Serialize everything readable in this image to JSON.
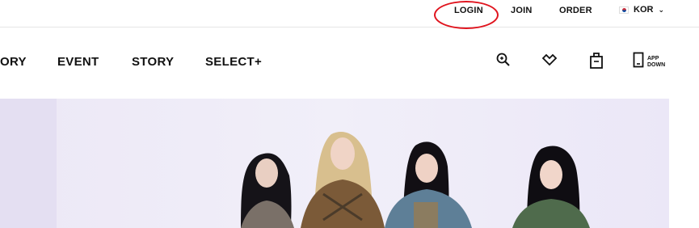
{
  "util": {
    "login": "LOGIN",
    "join": "JOIN",
    "order": "ORDER",
    "language": "KOR"
  },
  "nav": {
    "items": [
      "ORY",
      "EVENT",
      "STORY",
      "SELECT+"
    ]
  },
  "icons": {
    "search": "search-icon",
    "wishlist": "heart-icon",
    "bag": "shopping-bag-icon",
    "app": "mobile-phone-icon"
  },
  "app_down": {
    "line1": "APP",
    "line2": "DOWN"
  },
  "colors": {
    "highlight": "#e0141e",
    "hero_bg": "#ece8f6"
  }
}
